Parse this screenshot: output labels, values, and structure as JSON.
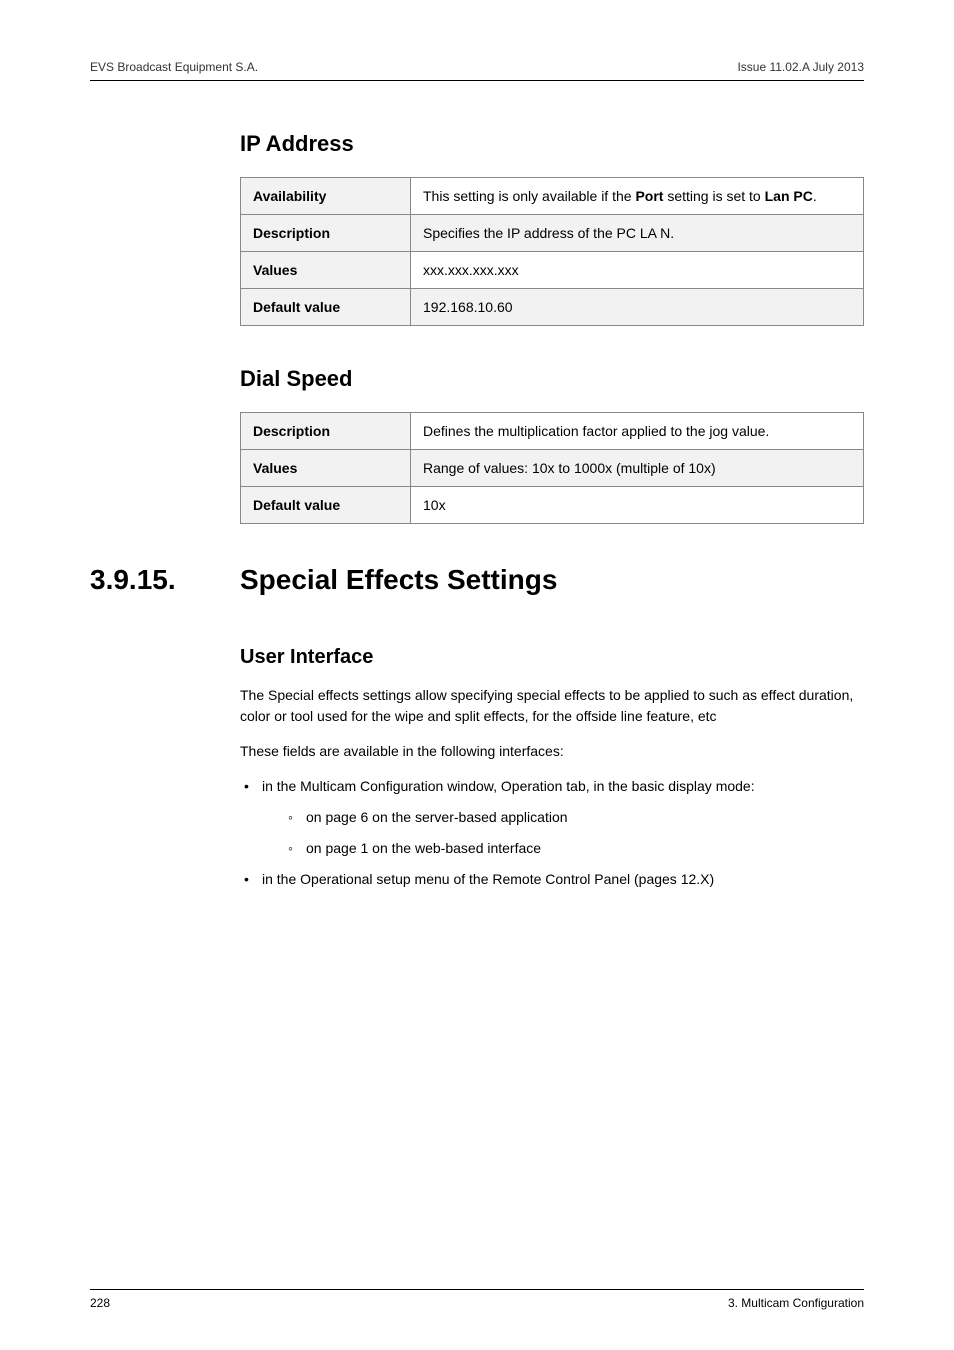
{
  "header": {
    "left": "EVS Broadcast Equipment S.A.",
    "right": "Issue 11.02.A  July 2013"
  },
  "ip_address": {
    "heading": "IP Address",
    "rows": {
      "availability": {
        "label": "Availability",
        "prefix": "This setting is only available if the ",
        "bold1": "Port",
        "mid": " setting is set to ",
        "bold2": "Lan PC",
        "suffix": "."
      },
      "description": {
        "label": "Description",
        "value": "Specifies the IP address of the PC LA N."
      },
      "values": {
        "label": "Values",
        "value": "xxx.xxx.xxx.xxx"
      },
      "default": {
        "label": "Default value",
        "value": "192.168.10.60"
      }
    }
  },
  "dial_speed": {
    "heading": "Dial Speed",
    "rows": {
      "description": {
        "label": "Description",
        "value": "Defines the multiplication factor applied to the jog value."
      },
      "values": {
        "label": "Values",
        "value": "Range of values: 10x to 1000x (multiple of 10x)"
      },
      "default": {
        "label": "Default value",
        "value": "10x"
      }
    }
  },
  "section": {
    "number": "3.9.15.",
    "title": "Special Effects Settings"
  },
  "user_interface": {
    "heading": "User Interface",
    "para1": "The Special effects settings allow specifying special effects to be applied to such as effect duration, color or tool used for the wipe and split effects, for the offside line feature, etc",
    "para2": "These fields are available in the following interfaces:",
    "bullets": {
      "b1": "in the Multicam Configuration window, Operation tab, in the basic display mode:",
      "b1a": "on page 6 on the server-based application",
      "b1b": "on page 1 on the web-based interface",
      "b2": "in the Operational setup menu of the Remote Control Panel (pages 12.X)"
    }
  },
  "footer": {
    "left": "228",
    "right": "3. Multicam Configuration"
  }
}
